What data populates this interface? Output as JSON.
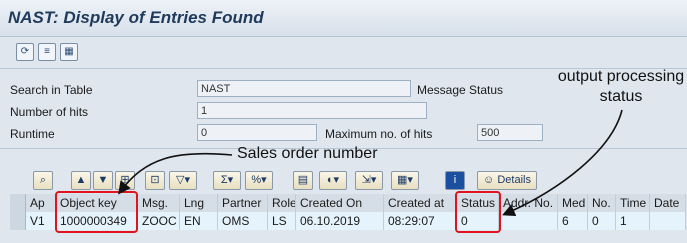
{
  "window": {
    "title": "NAST: Display of Entries Found"
  },
  "toolbar": {
    "icons": [
      "refresh-icon",
      "filter-settings-icon",
      "table-icon"
    ]
  },
  "selection": {
    "search_in_table": {
      "label": "Search in Table",
      "value": "NAST",
      "description": "Message Status"
    },
    "number_of_hits": {
      "label": "Number of hits",
      "value": "1"
    },
    "runtime": {
      "label": "Runtime",
      "value": "0",
      "max_label": "Maximum no. of hits",
      "max_value": "500"
    }
  },
  "alv_toolbar": {
    "details_label": "Details"
  },
  "table": {
    "columns": [
      "Ap",
      "Object key",
      "Msg.",
      "Lng",
      "Partner",
      "Role",
      "Created On",
      "Created at",
      "Status",
      "Addr. No.",
      "Med",
      "No.",
      "Time",
      "Date"
    ],
    "rows": [
      [
        "V1",
        "1000000349",
        "ZOOC",
        "EN",
        "OMS",
        "LS",
        "06.10.2019",
        "08:29:07",
        "0",
        "",
        "6",
        "0",
        "1",
        ""
      ]
    ]
  },
  "annotations": {
    "sales_order": "Sales order number",
    "output_line1": "output processing",
    "output_line2": "status"
  }
}
